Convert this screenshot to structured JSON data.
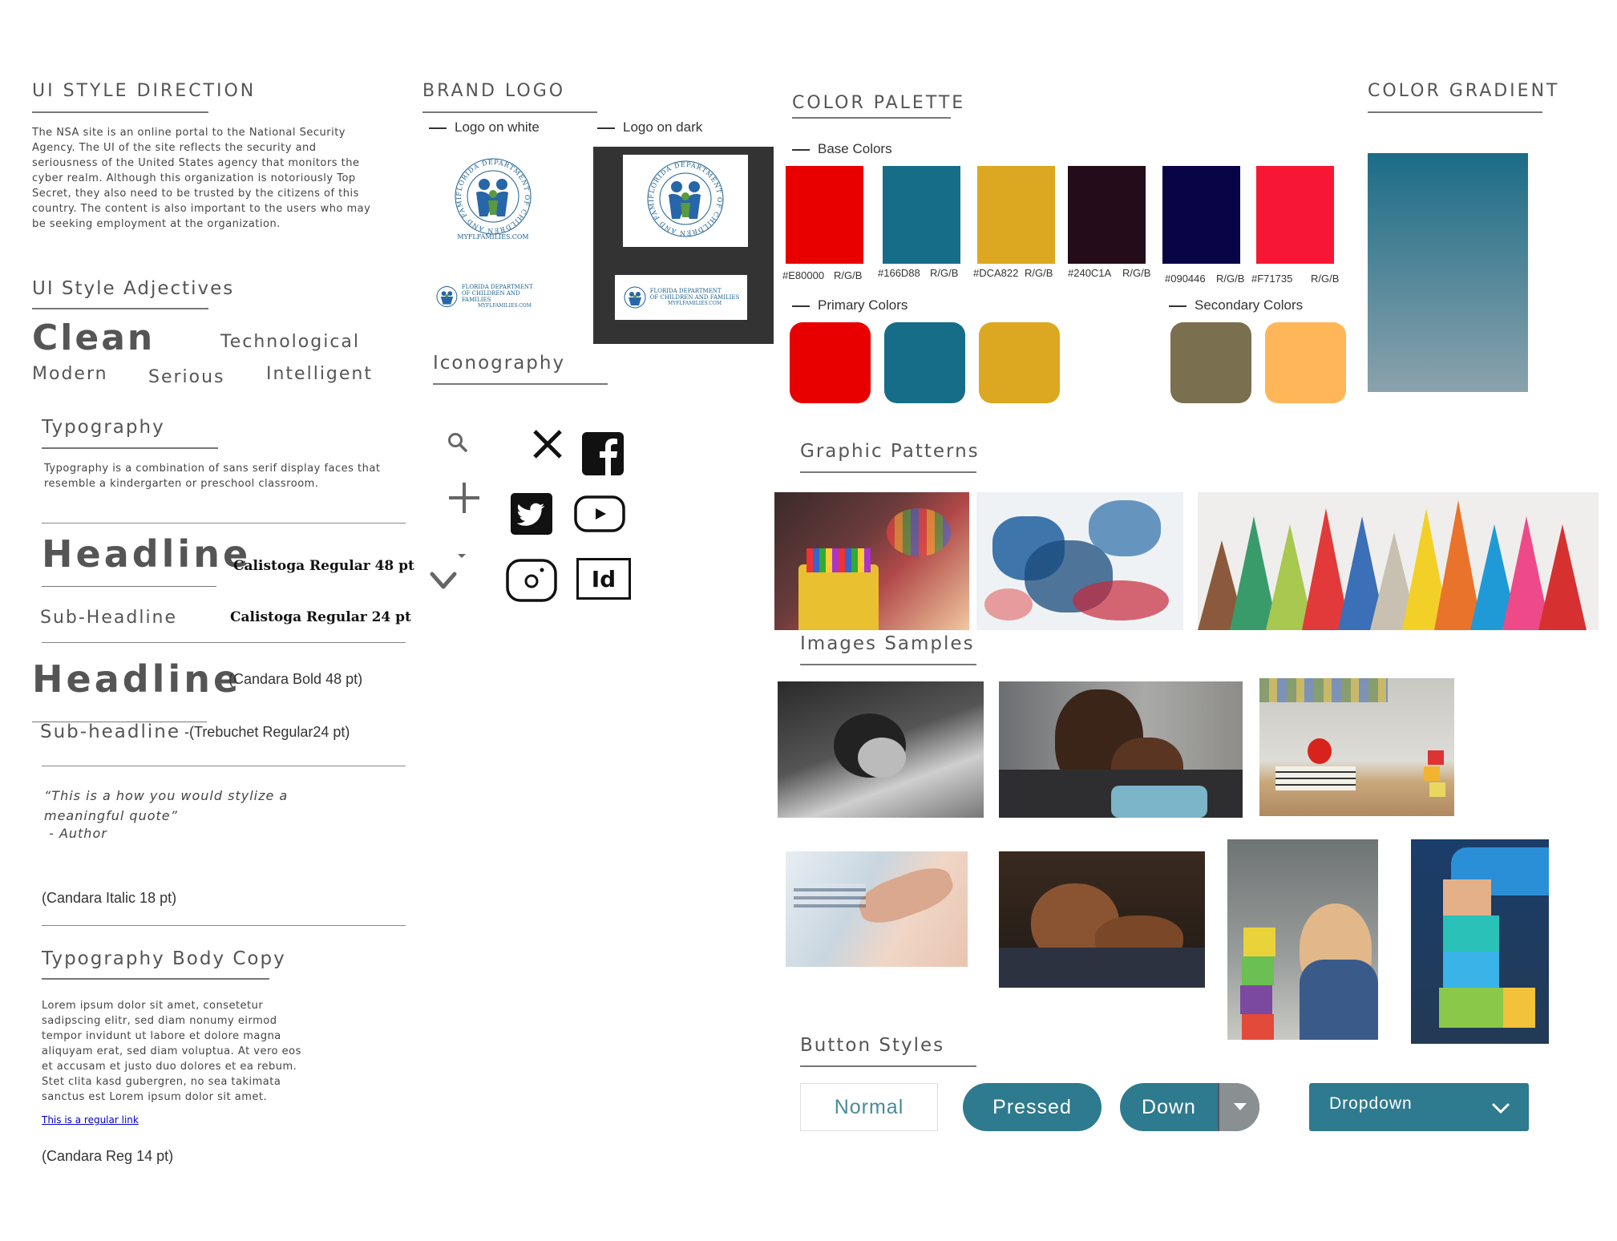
{
  "style_direction": {
    "title": "UI STYLE DIRECTION",
    "body": "The NSA site is an online portal to the National Security Agency.  The UI of the site reflects the security and seriousness of the United States agency that monitors the cyber realm. Although this organization is notoriously Top Secret, they also need to be trusted by the citizens of this country.  The content is also important to the users who may be seeking employment at the organization."
  },
  "adjectives": {
    "title": "UI Style Adjectives",
    "words": [
      "Clean",
      "Technological",
      "Modern",
      "Serious",
      "Intelligent"
    ]
  },
  "typography": {
    "title": "Typography",
    "desc": "Typography is a combination of sans serif display faces that resemble a kindergarten or preschool classroom.",
    "headline1": "Headline",
    "headline1_spec": "Calistoga Regular 48 pt",
    "subheadline1": "Sub-Headline",
    "subheadline1_spec": "Calistoga Regular 24 pt",
    "headline2": "Headline",
    "headline2_spec": "(Candara  Bold 48 pt)",
    "subheadline2": "Sub-headline",
    "subheadline2_spec": "-(Trebuchet Regular24 pt)",
    "quote": "“This is a how you would stylize a meaningful quote”",
    "quote_author": " - Author",
    "quote_spec": "(Candara Italic 18 pt)",
    "body_title": "Typography Body Copy",
    "body_text": "Lorem ipsum dolor sit amet, consetetur sadipscing elitr, sed diam nonumy eirmod tempor invidunt ut labore et dolore magna aliquyam erat, sed diam voluptua. At vero eos et accusam et justo duo dolores et ea rebum. Stet clita kasd gubergren, no sea takimata sanctus est Lorem ipsum dolor sit amet.",
    "link_text": "This is a regular link",
    "body_spec": "(Candara Reg 14 pt)"
  },
  "brand_logo": {
    "title": "BRAND LOGO",
    "on_white_label": "Logo on white",
    "on_dark_label": "Logo on dark",
    "logo_ring_text": "FLORIDA DEPARTMENT OF CHILDREN AND FAMILIES",
    "logo_url_text": "MyFLFamilies.com",
    "logo_h_line1": "FLORIDA DEPARTMENT",
    "logo_h_line2": "OF CHILDREN AND FAMILIES",
    "logo_h_line3": "MyFLFamilies.com"
  },
  "iconography": {
    "title": "Iconography",
    "icons": [
      "search-icon",
      "plus-icon",
      "small-caret-icon",
      "chevron-down-icon",
      "close-icon",
      "facebook-icon",
      "twitter-icon",
      "youtube-icon",
      "instagram-icon",
      "indesign-icon"
    ],
    "id_label": "Id"
  },
  "palette": {
    "title": "COLOR PALETTE",
    "base_label": "Base Colors",
    "base": [
      {
        "hex": "#E80000",
        "label": "#E80000",
        "rgb": "R/G/B"
      },
      {
        "hex": "#166D88",
        "label": "#166D88",
        "rgb": "R/G/B"
      },
      {
        "hex": "#DCA822",
        "label": "#DCA822",
        "rgb": "R/G/B"
      },
      {
        "hex": "#240C1A",
        "label": "#240C1A",
        "rgb": "R/G/B"
      },
      {
        "hex": "#090446",
        "label": "#090446",
        "rgb": "R/G/B"
      },
      {
        "hex": "#F71735",
        "label": "#F71735",
        "rgb": "R/G/B"
      }
    ],
    "primary_label": "Primary Colors",
    "primary": [
      "#E80000",
      "#166D88",
      "#DCA822"
    ],
    "secondary_label": "Secondary Colors",
    "secondary": [
      "#7A7050",
      "#FFB658"
    ]
  },
  "gradient": {
    "title": "COLOR GRADIENT",
    "from": "#1B6C88",
    "to": "#8BA2AC"
  },
  "patterns": {
    "title": "Graphic Patterns"
  },
  "images": {
    "title": "Images Samples"
  },
  "buttons": {
    "title": "Button Styles",
    "normal": "Normal",
    "pressed": "Pressed",
    "down": "Down",
    "dropdown": "Dropdown",
    "accent": "#2E7A8F"
  }
}
